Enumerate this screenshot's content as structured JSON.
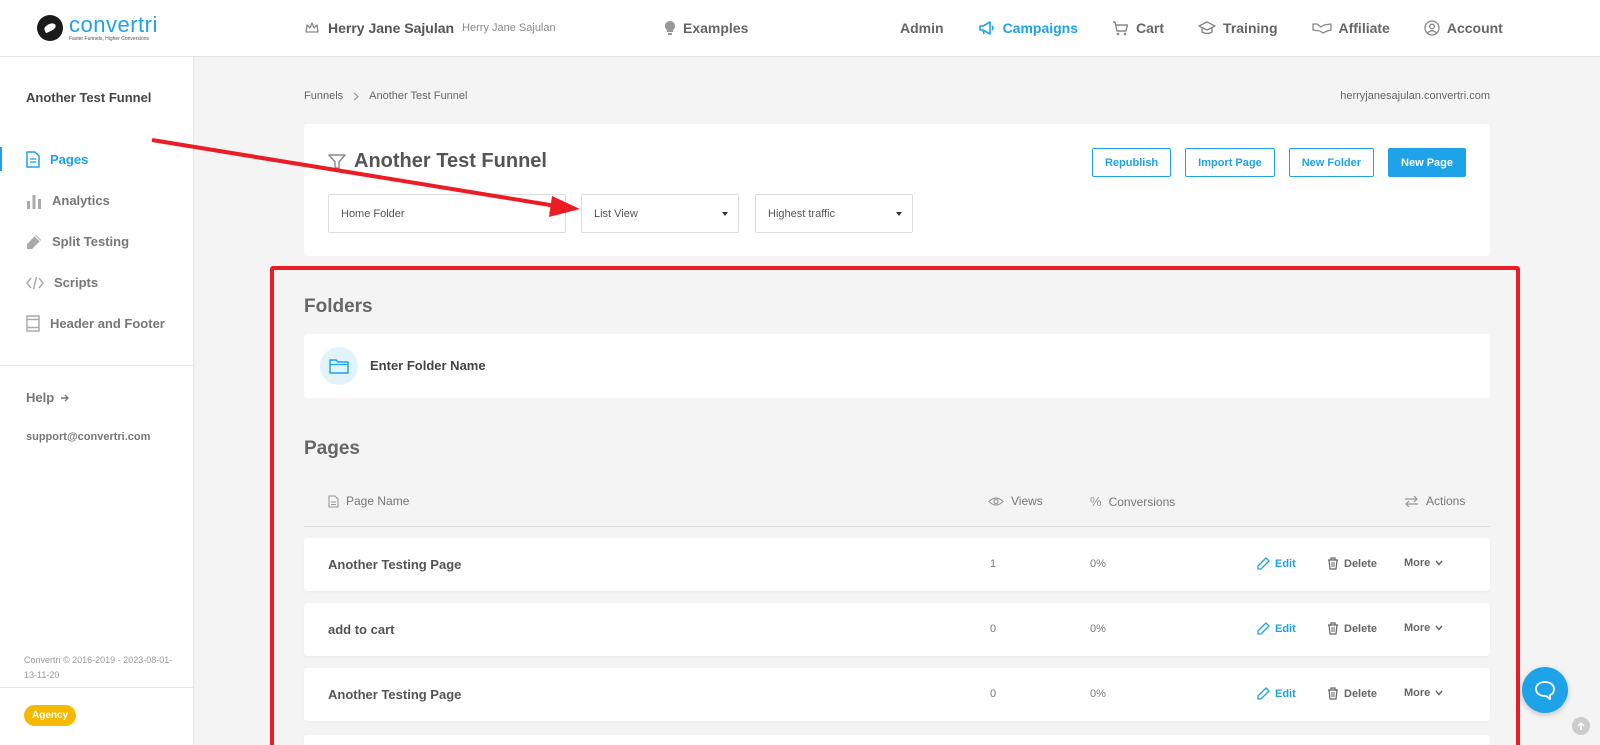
{
  "brand": {
    "name": "convertri",
    "tagline": "Faster Funnels, Higher Conversions"
  },
  "header": {
    "user_name": "Herry Jane Sajulan",
    "user_sub": "Herry Jane Sajulan",
    "examples": "Examples",
    "nav": [
      {
        "label": "Admin",
        "icon": "none"
      },
      {
        "label": "Campaigns",
        "icon": "megaphone-icon",
        "active": true
      },
      {
        "label": "Cart",
        "icon": "cart-icon"
      },
      {
        "label": "Training",
        "icon": "graduation-cap-icon"
      },
      {
        "label": "Affiliate",
        "icon": "handshake-icon"
      },
      {
        "label": "Account",
        "icon": "user-circle-icon"
      }
    ]
  },
  "sidebar": {
    "title": "Another Test Funnel",
    "items": [
      {
        "label": "Pages",
        "icon": "page-icon",
        "active": true
      },
      {
        "label": "Analytics",
        "icon": "bar-chart-icon"
      },
      {
        "label": "Split Testing",
        "icon": "flask-icon"
      },
      {
        "label": "Scripts",
        "icon": "code-icon"
      },
      {
        "label": "Header and Footer",
        "icon": "layout-icon"
      }
    ],
    "help": "Help",
    "support": "support@convertri.com",
    "copyright": "Convertri © 2016-2019 - 2023-08-01-13-11-20",
    "badge": "Agency"
  },
  "breadcrumb": {
    "root": "Funnels",
    "current": "Another Test Funnel"
  },
  "domain": "herryjanesajulan.convertri.com",
  "funnel": {
    "title": "Another Test Funnel",
    "buttons": {
      "republish": "Republish",
      "import": "Import Page",
      "new_folder": "New Folder",
      "new_page": "New Page"
    },
    "filters": {
      "folder": "Home Folder",
      "view": "List View",
      "sort": "Highest traffic"
    }
  },
  "folders": {
    "title": "Folders",
    "placeholder": "Enter Folder Name"
  },
  "pages": {
    "title": "Pages",
    "columns": {
      "name": "Page Name",
      "views": "Views",
      "conversions": "Conversions",
      "actions": "Actions"
    },
    "rows": [
      {
        "name": "Another Testing Page",
        "views": "1",
        "conversions": "0%"
      },
      {
        "name": "add to cart",
        "views": "0",
        "conversions": "0%"
      },
      {
        "name": "Another Testing Page",
        "views": "0",
        "conversions": "0%"
      }
    ],
    "actions": {
      "edit": "Edit",
      "delete": "Delete",
      "more": "More"
    }
  },
  "colors": {
    "accent": "#1ea2e8",
    "annotation": "#ec1c24",
    "badge": "#f6b800"
  }
}
